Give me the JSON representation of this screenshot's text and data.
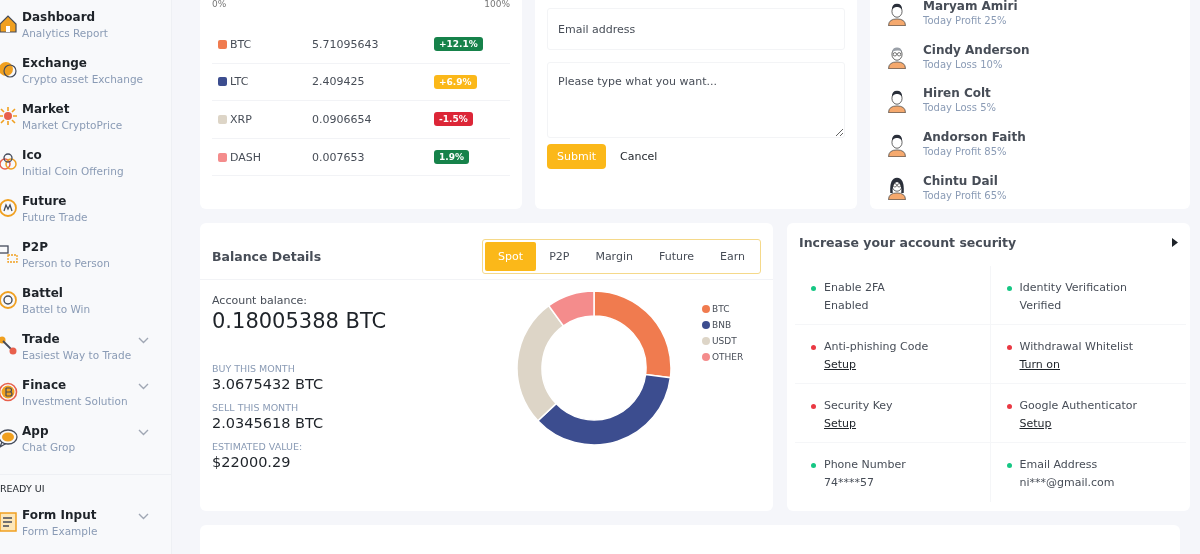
{
  "sidebar": {
    "items": [
      {
        "title": "Dashboard",
        "subtitle": "Analytics Report",
        "expandable": false
      },
      {
        "title": "Exchange",
        "subtitle": "Crypto asset Exchange",
        "expandable": false
      },
      {
        "title": "Market",
        "subtitle": "Market CryptoPrice",
        "expandable": false
      },
      {
        "title": "Ico",
        "subtitle": "Initial Coin Offering",
        "expandable": false
      },
      {
        "title": "Future",
        "subtitle": "Future Trade",
        "expandable": false
      },
      {
        "title": "P2P",
        "subtitle": "Person to Person",
        "expandable": false
      },
      {
        "title": "Battel",
        "subtitle": "Battel to Win",
        "expandable": false
      },
      {
        "title": "Trade",
        "subtitle": "Easiest Way to Trade",
        "expandable": true
      },
      {
        "title": "Finace",
        "subtitle": "Investment Solution",
        "expandable": true
      },
      {
        "title": "App",
        "subtitle": "Chat Grop",
        "expandable": true
      }
    ],
    "section": "READY UI",
    "section_items": [
      {
        "title": "Form Input",
        "subtitle": "Form Example",
        "expandable": true
      }
    ]
  },
  "holdings": {
    "scale": [
      "0%",
      "100%"
    ],
    "rows": [
      {
        "coin": "BTC",
        "color": "#f07b4f",
        "amount": "5.71095643",
        "change": "+12.1%",
        "kind": "gain"
      },
      {
        "coin": "LTC",
        "color": "#3c4d8f",
        "amount": "2.409425",
        "change": "+6.9%",
        "kind": "mild"
      },
      {
        "coin": "XRP",
        "color": "#ddd5c7",
        "amount": "0.0906654",
        "change": "-1.5%",
        "kind": "loss"
      },
      {
        "coin": "DASH",
        "color": "#f48c8c",
        "amount": "0.007653",
        "change": "1.9%",
        "kind": "gain"
      }
    ]
  },
  "contact_form": {
    "email": {
      "placeholder": "Email address"
    },
    "message": {
      "placeholder": "Please type what you want..."
    },
    "buttons": [
      "Submit",
      "Cancel"
    ]
  },
  "traders": [
    {
      "name": "Maryam Amiri",
      "result": "Today Profit 25%"
    },
    {
      "name": "Cindy Anderson",
      "result": "Today Loss 10%"
    },
    {
      "name": "Hiren Colt",
      "result": "Today Loss 5%"
    },
    {
      "name": "Andorson Faith",
      "result": "Today Profit 85%"
    },
    {
      "name": "Chintu Dail",
      "result": "Today Profit 65%"
    }
  ],
  "balance": {
    "title": "Balance Details",
    "tabs": [
      {
        "label": "Spot",
        "selected": true
      },
      {
        "label": "P2P",
        "selected": false
      },
      {
        "label": "Margin",
        "selected": false
      },
      {
        "label": "Future",
        "selected": false
      },
      {
        "label": "Earn",
        "selected": false
      }
    ],
    "account_label": "Account balance:",
    "account_value": "0.18005388 BTC",
    "stats": [
      {
        "label": "BUY THIS MONTH",
        "value": "3.0675432 BTC"
      },
      {
        "label": "SELL THIS MONTH",
        "value": "2.0345618 BTC"
      },
      {
        "label": "ESTIMATED VALUE:",
        "value": "$22000.29"
      }
    ],
    "legend": [
      {
        "label": "BTC",
        "color": "#f07b4f"
      },
      {
        "label": "BNB",
        "color": "#3c4d8f"
      },
      {
        "label": "USDT",
        "color": "#ddd5c7"
      },
      {
        "label": "OTHER",
        "color": "#f48c8c"
      }
    ]
  },
  "security": {
    "title": "Increase your account security",
    "items": [
      {
        "label": "Enable 2FA",
        "value": "Enabled",
        "kind": "text",
        "color": "#16c784"
      },
      {
        "label": "Identity Verification",
        "value": "Verified",
        "kind": "text",
        "color": "#16c784"
      },
      {
        "label": "Anti-phishing Code",
        "value": "Setup",
        "kind": "link",
        "color": "#ea3943"
      },
      {
        "label": "Withdrawal Whitelist",
        "value": "Turn on",
        "kind": "link",
        "color": "#ea3943"
      },
      {
        "label": "Security Key",
        "value": "Setup",
        "kind": "link",
        "color": "#ea3943"
      },
      {
        "label": "Google Authenticator",
        "value": "Setup",
        "kind": "link",
        "color": "#ea3943"
      },
      {
        "label": "Phone Number",
        "value": "74****57",
        "kind": "text",
        "color": "#16c784"
      },
      {
        "label": "Email Address",
        "value": "ni***@gmail.com",
        "kind": "text",
        "color": "#16c784"
      }
    ]
  }
}
